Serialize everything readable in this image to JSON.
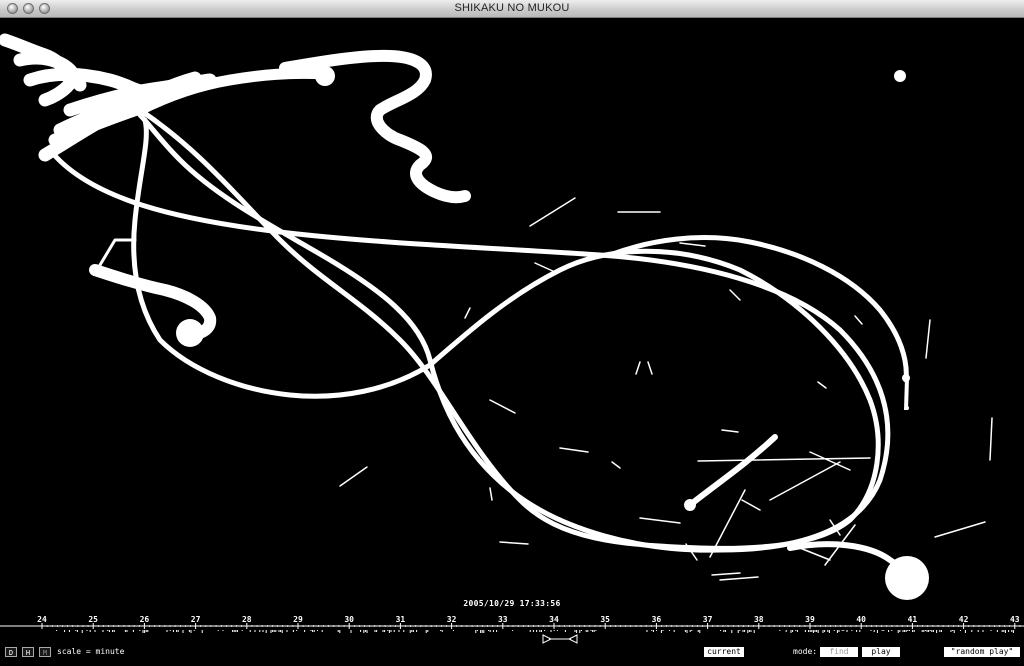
{
  "window": {
    "title": "SHIKAKU NO MUKOU"
  },
  "timestamp": "2005/10/29 17:33:56",
  "timeline": {
    "ticks": [
      "24",
      "25",
      "26",
      "27",
      "28",
      "29",
      "30",
      "31",
      "32",
      "33",
      "34",
      "35",
      "36",
      "37",
      "38",
      "39",
      "40",
      "41",
      "42",
      "43"
    ]
  },
  "controls": {
    "scale_buttons": [
      "D",
      "H",
      "M"
    ],
    "scale_label": "scale = minute",
    "current_button": "current",
    "mode_label": "mode:",
    "find_button": "find",
    "play_button": "play",
    "random_play_button": "\"random play\""
  },
  "colors": {
    "background": "#000000",
    "stroke": "#ffffff",
    "titlebar": "#d0d0d0"
  }
}
